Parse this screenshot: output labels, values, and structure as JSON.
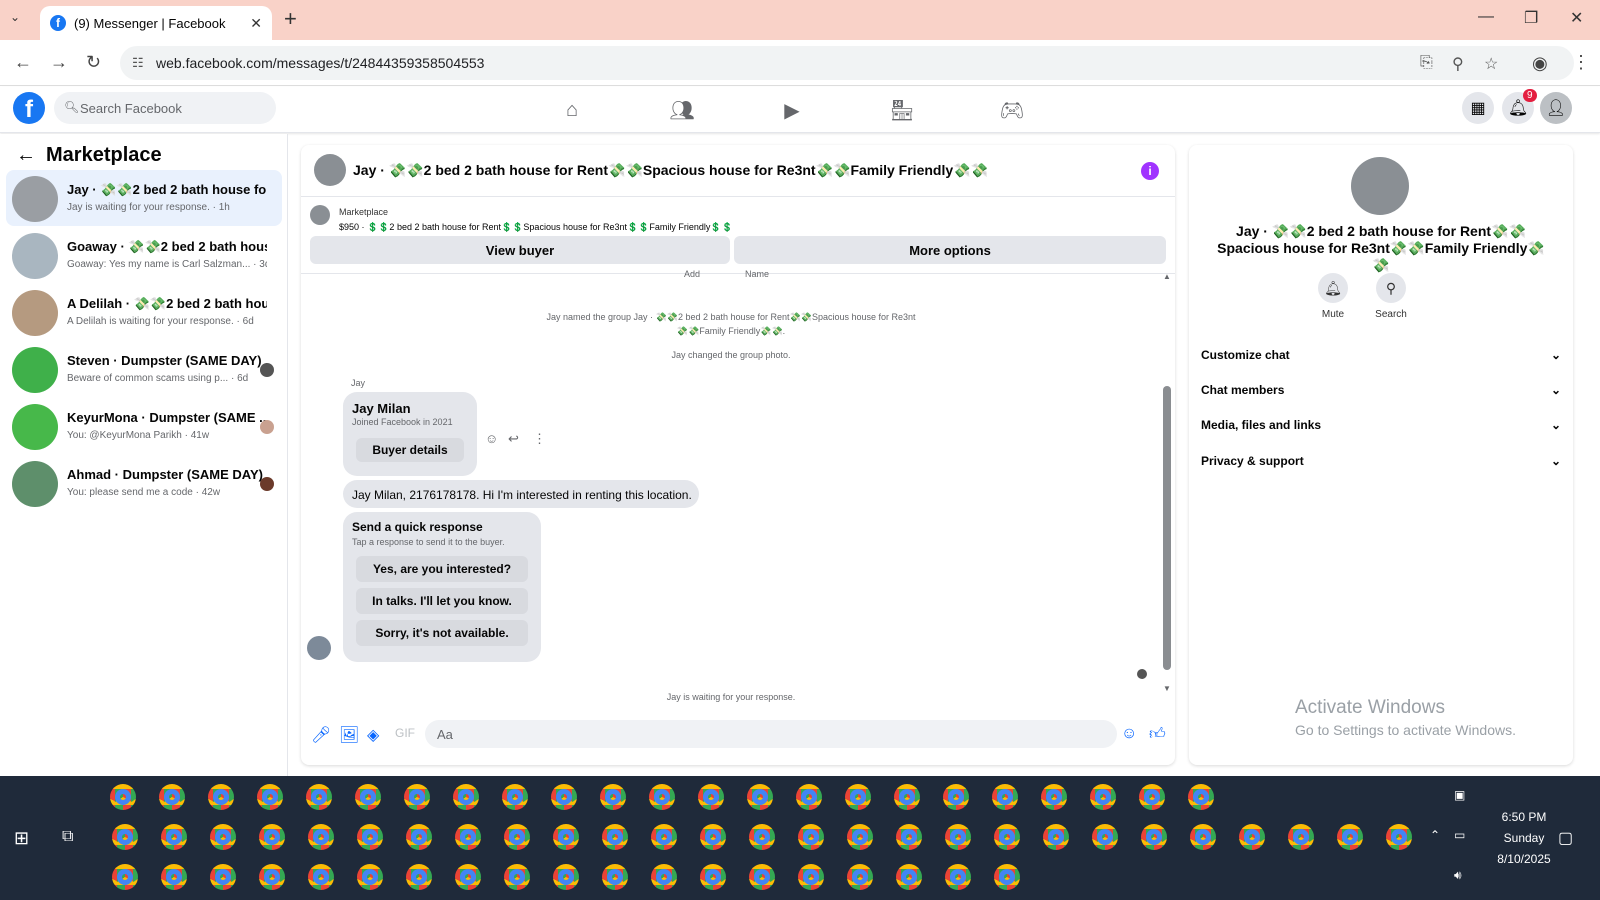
{
  "browser": {
    "tab_title": "(9) Messenger | Facebook",
    "url": "web.facebook.com/messages/t/24844359358504553"
  },
  "fb": {
    "search_placeholder": "Search Facebook",
    "notification_count": "9"
  },
  "left": {
    "heading": "Marketplace",
    "conversations": [
      {
        "name": "Jay · 💸💸2 bed 2 bath house for ...",
        "sub": "Jay is waiting for your response. · 1h",
        "active": true
      },
      {
        "name": "Goaway · 💸💸2 bed 2 bath house...",
        "sub": "Goaway: Yes my name is Carl Salzman... · 3d"
      },
      {
        "name": "A Delilah · 💸💸2 bed 2 bath hous...",
        "sub": "A Delilah is waiting for your response. · 6d"
      },
      {
        "name": "Steven · Dumpster (SAME DAY) ...",
        "sub": "Beware of common scams using p... · 6d"
      },
      {
        "name": "KeyurMona · Dumpster (SAME ...",
        "sub": "You: @KeyurMona Parikh · 41w"
      },
      {
        "name": "Ahmad · Dumpster (SAME DAY) ...",
        "sub": "You: please send me a code · 42w"
      }
    ]
  },
  "chat": {
    "title": "Jay · 💸💸2 bed 2 bath house for Rent💸💸Spacious house for Re3nt💸💸Family Friendly💸💸",
    "marketplace_label": "Marketplace",
    "listing_line": "$950 · 💲💲2 bed 2 bath house for Rent💲💲Spacious house for Re3nt💲💲Family Friendly💲💲",
    "view_buyer": "View buyer",
    "more_options": "More options",
    "clipped_add": "Add",
    "clipped_name": "Name",
    "sys_named": "Jay named the group Jay · 💸💸2 bed 2 bath house for Rent💸💸Spacious house for Re3nt💸💸Family Friendly💸💸.",
    "sys_photo": "Jay changed the group photo.",
    "sender": "Jay",
    "card_name": "Jay Milan",
    "card_joined": "Joined Facebook in 2021",
    "buyer_details": "Buyer details",
    "message": "Jay Milan, 2176178178. Hi I'm interested in renting this location.",
    "quick_title": "Send a quick response",
    "quick_sub": "Tap a response to send it to the buyer.",
    "quick_1": "Yes, are you interested?",
    "quick_2": "In talks. I'll let you know.",
    "quick_3": "Sorry, it's not available.",
    "waiting": "Jay is waiting for your response.",
    "composer_placeholder": "Aa"
  },
  "right": {
    "title": "Jay · 💸💸2 bed 2 bath house for Rent💸💸Spacious house for Re3nt💸💸Family Friendly💸💸",
    "mute": "Mute",
    "search": "Search",
    "rows": [
      "Customize chat",
      "Chat members",
      "Media, files and links",
      "Privacy & support"
    ],
    "activate_1": "Activate Windows",
    "activate_2": "Go to Settings to activate Windows."
  },
  "taskbar": {
    "time": "6:50 PM",
    "day": "Sunday",
    "date": "8/10/2025"
  },
  "colors": {
    "fb_blue": "#1877f2",
    "messenger_blue": "#0866ff",
    "info_purple": "#a033ff",
    "taskbar": "#1f2a3a"
  }
}
